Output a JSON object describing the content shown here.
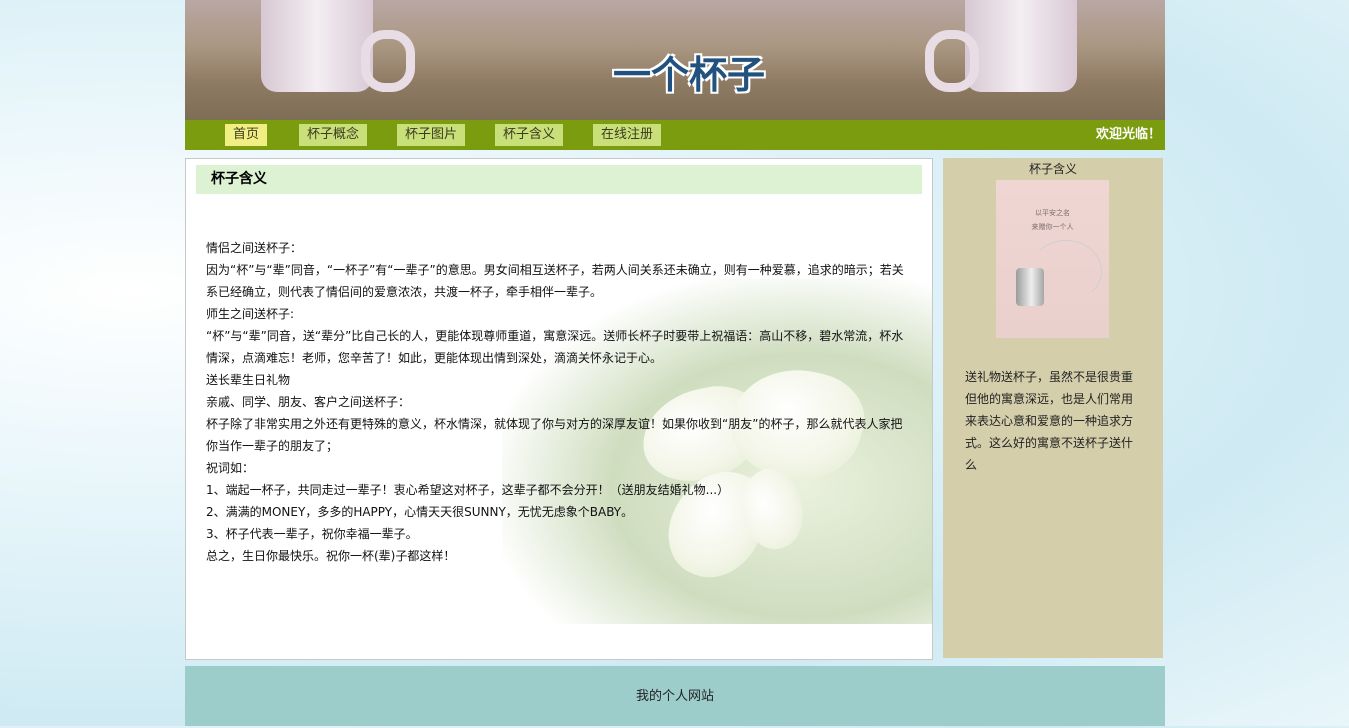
{
  "header": {
    "site_title": "一个杯子"
  },
  "nav": {
    "items": [
      {
        "label": "首页"
      },
      {
        "label": "杯子概念"
      },
      {
        "label": "杯子图片"
      },
      {
        "label": "杯子含义"
      },
      {
        "label": "在线注册"
      }
    ],
    "welcome": "欢迎光临！"
  },
  "main": {
    "title": "杯子含义",
    "paragraphs": [
      "情侣之间送杯子：",
      "因为“杯”与“辈”同音，“一杯子”有“一辈子”的意思。男女间相互送杯子，若两人间关系还未确立，则有一种爱慕，追求的暗示；若关系已经确立，则代表了情侣间的爱意浓浓，共渡一杯子，牵手相伴一辈子。",
      "师生之间送杯子:",
      "“杯”与“辈”同音，送“辈分”比自己长的人，更能体现尊师重道，寓意深远。送师长杯子时要带上祝福语：高山不移，碧水常流，杯水情深，点滴难忘！老师，您辛苦了！如此，更能体现出情到深处，滴滴关怀永记于心。",
      "送长辈生日礼物",
      "亲戚、同学、朋友、客户之间送杯子：",
      "杯子除了非常实用之外还有更特殊的意义，杯水情深，就体现了你与对方的深厚友谊！如果你收到“朋友”的杯子，那么就代表人家把你当作一辈子的朋友了；",
      "祝词如：",
      "1、端起一杯子，共同走过一辈子！衷心希望这对杯子，这辈子都不会分开！（送朋友结婚礼物...）",
      "2、满满的MONEY，多多的HAPPY，心情天天很SUNNY，无忧无虑象个BABY。",
      "3、杯子代表一辈子，祝你幸福一辈子。",
      "总之，生日你最快乐。祝你一杯(辈)子都这样！"
    ]
  },
  "sidebar": {
    "title": "杯子含义",
    "image_text_line1": "以平安之名",
    "image_text_line2": "来赠你一个人",
    "text": "送礼物送杯子，虽然不是很贵重但他的寓意深远，也是人们常用来表达心意和爱意的一种追求方式。这么好的寓意不送杯子送什么"
  },
  "footer": {
    "text": "我的个人网站"
  }
}
